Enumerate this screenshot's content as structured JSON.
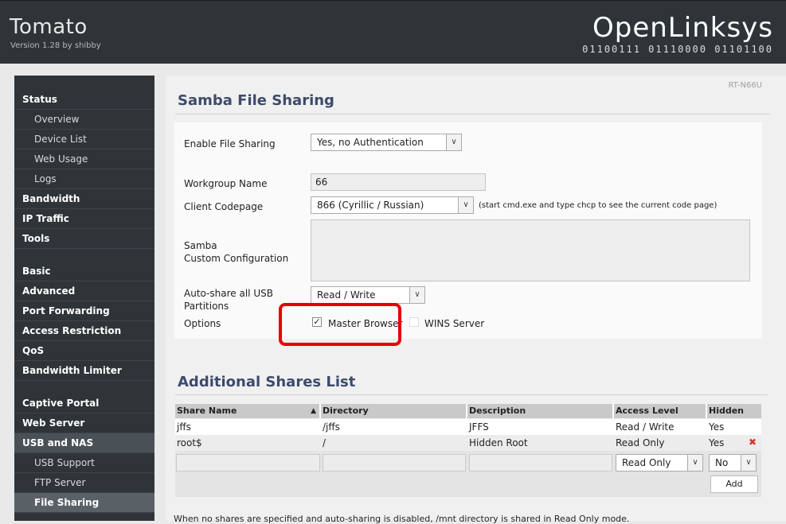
{
  "header": {
    "brand": "Tomato",
    "version": "Version 1.28 by shibby",
    "logo": "OpenLinksys",
    "binary": "01100111 01110000 01101100"
  },
  "sidebar": {
    "items": [
      {
        "label": "Status"
      },
      {
        "label": "Overview"
      },
      {
        "label": "Device List"
      },
      {
        "label": "Web Usage"
      },
      {
        "label": "Logs"
      },
      {
        "label": "Bandwidth"
      },
      {
        "label": "IP Traffic"
      },
      {
        "label": "Tools"
      },
      {
        "label": "Basic"
      },
      {
        "label": "Advanced"
      },
      {
        "label": "Port Forwarding"
      },
      {
        "label": "Access Restriction"
      },
      {
        "label": "QoS"
      },
      {
        "label": "Bandwidth Limiter"
      },
      {
        "label": "Captive Portal"
      },
      {
        "label": "Web Server"
      },
      {
        "label": "USB and NAS"
      },
      {
        "label": "USB Support"
      },
      {
        "label": "FTP Server"
      },
      {
        "label": "File Sharing"
      }
    ]
  },
  "content": {
    "model": "RT-N66U",
    "samba_title": "Samba File Sharing",
    "enable_label": "Enable File Sharing",
    "enable_value": "Yes, no Authentication",
    "workgroup_label": "Workgroup Name",
    "workgroup_value": "66",
    "codepage_label": "Client Codepage",
    "codepage_value": "866 (Cyrillic / Russian)",
    "codepage_hint": "(start cmd.exe and type chcp to see the current code page)",
    "custom_label_1": "Samba",
    "custom_label_2": "Custom Configuration",
    "autoshare_label_1": "Auto-share all USB",
    "autoshare_label_2": "Partitions",
    "autoshare_value": "Read / Write",
    "options_label": "Options",
    "master_browser_label": "Master Browser",
    "wins_label": "WINS Server",
    "shares_title": "Additional Shares List",
    "footer_note": "When no shares are specified and auto-sharing is disabled, /mnt directory is shared in Read Only mode."
  },
  "shares": {
    "columns": [
      "Share Name",
      "Directory",
      "Description",
      "Access Level",
      "Hidden"
    ],
    "sort_indicator": "▲",
    "rows": [
      {
        "name": "jffs",
        "dir": "/jffs",
        "desc": "JFFS",
        "access": "Read / Write",
        "hidden": "Yes"
      },
      {
        "name": "root$",
        "dir": "/",
        "desc": "Hidden Root",
        "access": "Read Only",
        "hidden": "Yes"
      }
    ],
    "new_access": "Read Only",
    "new_hidden": "No",
    "add_label": "Add"
  },
  "icons": {
    "checkbox": "checkbox-checked-icon",
    "dropdown": "chevron-down-icon",
    "delete": "delete-x-icon"
  },
  "colors": {
    "header_bg": "#2f3438",
    "title_blue": "#3d4b6b",
    "highlight": "#e60000"
  }
}
